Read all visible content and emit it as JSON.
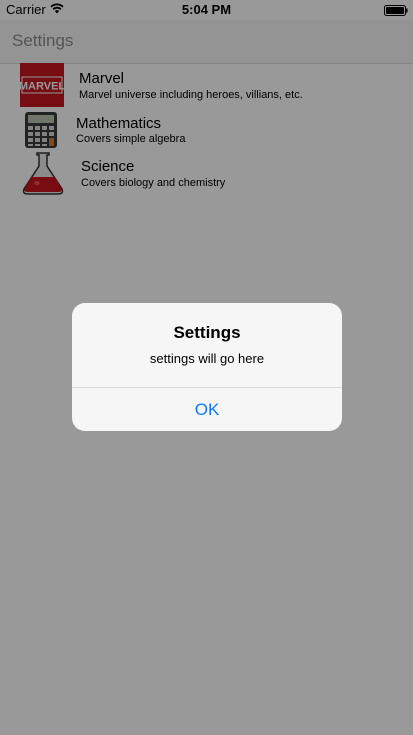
{
  "status_bar": {
    "carrier": "Carrier",
    "time": "5:04 PM"
  },
  "nav": {
    "title": "Settings"
  },
  "items": [
    {
      "title": "Marvel",
      "subtitle": "Marvel universe including heroes, villians, etc.",
      "icon": "marvel-logo-icon",
      "logo_text": "MARVEL"
    },
    {
      "title": "Mathematics",
      "subtitle": "Covers simple algebra",
      "icon": "calculator-icon"
    },
    {
      "title": "Science",
      "subtitle": "Covers biology and chemistry",
      "icon": "flask-icon"
    }
  ],
  "alert": {
    "title": "Settings",
    "message": "settings will go here",
    "button_label": "OK",
    "button_color": "#0a7aff"
  },
  "colors": {
    "marvel_red": "#c5171f",
    "flask_liquid": "#c8141e"
  }
}
